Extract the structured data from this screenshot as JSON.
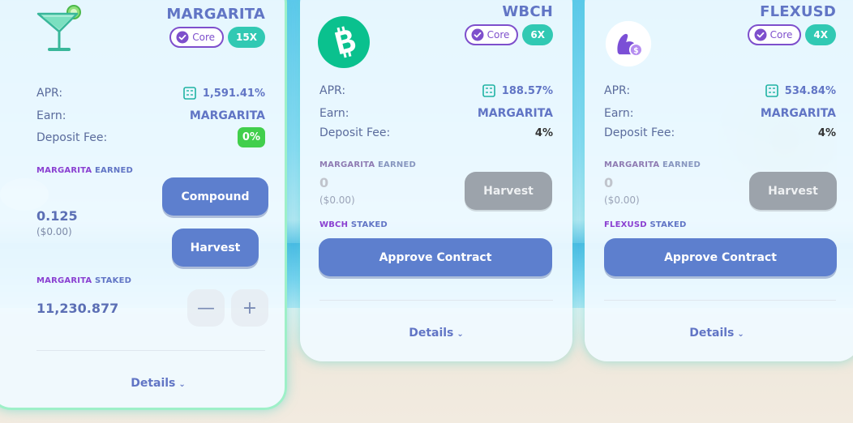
{
  "cards": [
    {
      "name": "MARGARITA",
      "tag_core": "Core",
      "multiplier": "15X",
      "apr_label": "APR:",
      "apr_value": "1,591.41%",
      "earn_label": "Earn:",
      "earn_value": "MARGARITA",
      "fee_label": "Deposit Fee:",
      "fee_value": "0%",
      "earned_token": "MARGARITA",
      "earned_word": "EARNED",
      "earned_amount": "0.125",
      "earned_usd": "($0.00)",
      "compound_label": "Compound",
      "harvest_label": "Harvest",
      "staked_token": "MARGARITA",
      "staked_word": "STAKED",
      "staked_amount": "11,230.877",
      "minus": "—",
      "plus": "+",
      "details": "Details",
      "chevron": "⌄"
    },
    {
      "name": "WBCH",
      "tag_core": "Core",
      "multiplier": "6X",
      "apr_label": "APR:",
      "apr_value": "188.57%",
      "earn_label": "Earn:",
      "earn_value": "MARGARITA",
      "fee_label": "Deposit Fee:",
      "fee_value": "4%",
      "earned_token": "MARGARITA",
      "earned_word": "EARNED",
      "earned_amount": "0",
      "earned_usd": "($0.00)",
      "harvest_label": "Harvest",
      "staked_token": "WBCH",
      "staked_word": "STAKED",
      "approve_label": "Approve Contract",
      "details": "Details",
      "chevron": "⌄"
    },
    {
      "name": "FLEXUSD",
      "tag_core": "Core",
      "multiplier": "4X",
      "apr_label": "APR:",
      "apr_value": "534.84%",
      "earn_label": "Earn:",
      "earn_value": "MARGARITA",
      "fee_label": "Deposit Fee:",
      "fee_value": "4%",
      "earned_token": "MARGARITA",
      "earned_word": "EARNED",
      "earned_amount": "0",
      "earned_usd": "($0.00)",
      "harvest_label": "Harvest",
      "staked_token": "FLEXUSD",
      "staked_word": "STAKED",
      "approve_label": "Approve Contract",
      "details": "Details",
      "chevron": "⌄"
    }
  ],
  "colors": {
    "accent": "#6175c5",
    "token_purple": "#8a3fd1",
    "multiplier_teal": "#31c9b3",
    "button_blue": "#5d7fce",
    "button_disabled": "#9ca3ab",
    "fee_green": "#41cf4c",
    "bch_green": "#0ac18e",
    "flexusd_purple": "#7b4fd6"
  },
  "icons": {
    "margarita": "margarita-glass-icon",
    "wbch": "bitcoin-cash-icon",
    "flexusd": "flexusd-arm-icon",
    "core": "verified-badge-icon",
    "apr": "calculator-icon",
    "details": "chevron-down-icon"
  }
}
